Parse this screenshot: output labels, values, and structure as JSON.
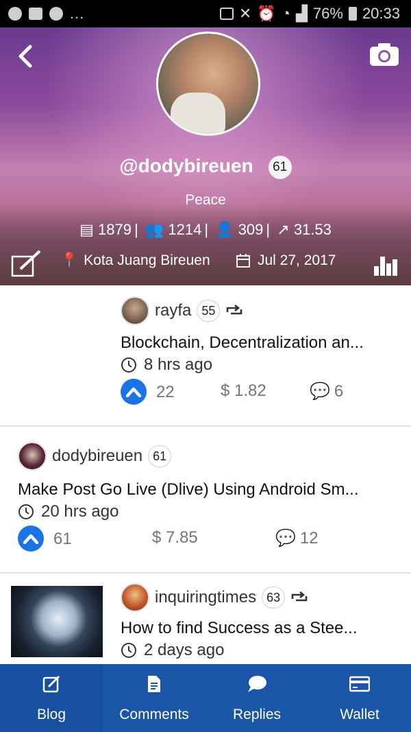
{
  "status_bar": {
    "left_overflow": "...",
    "battery": "76%",
    "time": "20:33"
  },
  "profile": {
    "username": "@dodybireuen",
    "reputation": "61",
    "bio": "Peace",
    "posts": "1879",
    "followers": "1214",
    "following": "309",
    "power": "31.53",
    "location": "Kota Juang Bireuen",
    "joined": "Jul 27, 2017"
  },
  "posts": [
    {
      "author": "rayfa",
      "reputation": "55",
      "resteemed": true,
      "title": "Blockchain, Decentralization an...",
      "time": "8 hrs ago",
      "votes": "22",
      "payout": "$ 1.82",
      "comments": "6"
    },
    {
      "author": "dodybireuen",
      "reputation": "61",
      "resteemed": false,
      "title": "Make Post Go Live (Dlive) Using Android Sm...",
      "time": "20 hrs ago",
      "votes": "61",
      "payout": "$ 7.85",
      "comments": "12"
    },
    {
      "author": "inquiringtimes",
      "reputation": "63",
      "resteemed": true,
      "title": "How to find Success as a Stee...",
      "time": "2 days ago"
    }
  ],
  "nav": {
    "blog": "Blog",
    "comments": "Comments",
    "replies": "Replies",
    "wallet": "Wallet"
  },
  "colors": {
    "accent": "#1a55a8",
    "upvote": "#1a74e8"
  }
}
